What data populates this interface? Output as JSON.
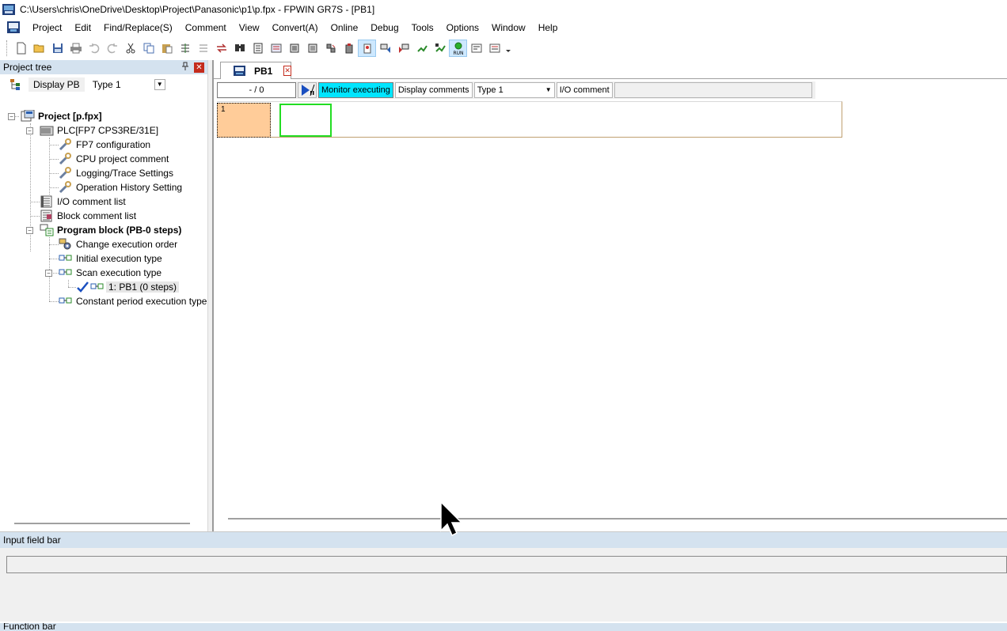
{
  "window": {
    "title": "C:\\Users\\chris\\OneDrive\\Desktop\\Project\\Panasonic\\p1\\p.fpx - FPWIN GR7S - [PB1]"
  },
  "menu": [
    "Project",
    "Edit",
    "Find/Replace(S)",
    "Comment",
    "View",
    "Convert(A)",
    "Online",
    "Debug",
    "Tools",
    "Options",
    "Window",
    "Help"
  ],
  "toolbar": {
    "buttons": [
      "new-icon",
      "open-icon",
      "save-icon",
      "print-icon",
      "undo-icon",
      "redo-icon",
      "cut-icon",
      "copy-icon",
      "paste-icon",
      "insert-row-icon",
      "delete-row-icon",
      "transfer-icon",
      "find-icon",
      "convert-icon",
      "block-icon",
      "monitor-icon",
      "online-icon",
      "program-icon",
      "forcing-icon",
      "plc-icon",
      "download-icon",
      "upload-icon",
      "compare-icon",
      "run-mode-icon",
      "run-icon",
      "status-icon",
      "dropdown-icon"
    ]
  },
  "project_tree": {
    "title": "Project tree",
    "pin": "↑",
    "close": "✕",
    "display_button": "Display PB",
    "type_select": "Type 1",
    "nodes": {
      "project": "Project [p.fpx]",
      "plc": "PLC[FP7 CPS3RE/31E]",
      "fp7_config": "FP7 configuration",
      "cpu_comment": "CPU project comment",
      "logging": "Logging/Trace Settings",
      "history": "Operation History Setting",
      "io_comment": "I/O comment list",
      "block_comment": "Block comment list",
      "program_block": "Program block (PB-0 steps)",
      "change_order": "Change execution order",
      "initial_exec": "Initial execution type",
      "scan_exec": "Scan execution type",
      "pb1": "1: PB1 (0 steps)",
      "constant_exec": "Constant period execution type"
    }
  },
  "editor": {
    "tab_label": "PB1",
    "tab_close": "✕",
    "address": "-  /      0",
    "monitor": "Monitor executing",
    "display_comments": "Display comments",
    "type_select": "Type 1",
    "io_comment": "I/O comment",
    "line_number": "1"
  },
  "input_bar": {
    "title": "Input field bar",
    "value": ""
  },
  "function_bar": {
    "title": "Function bar"
  }
}
